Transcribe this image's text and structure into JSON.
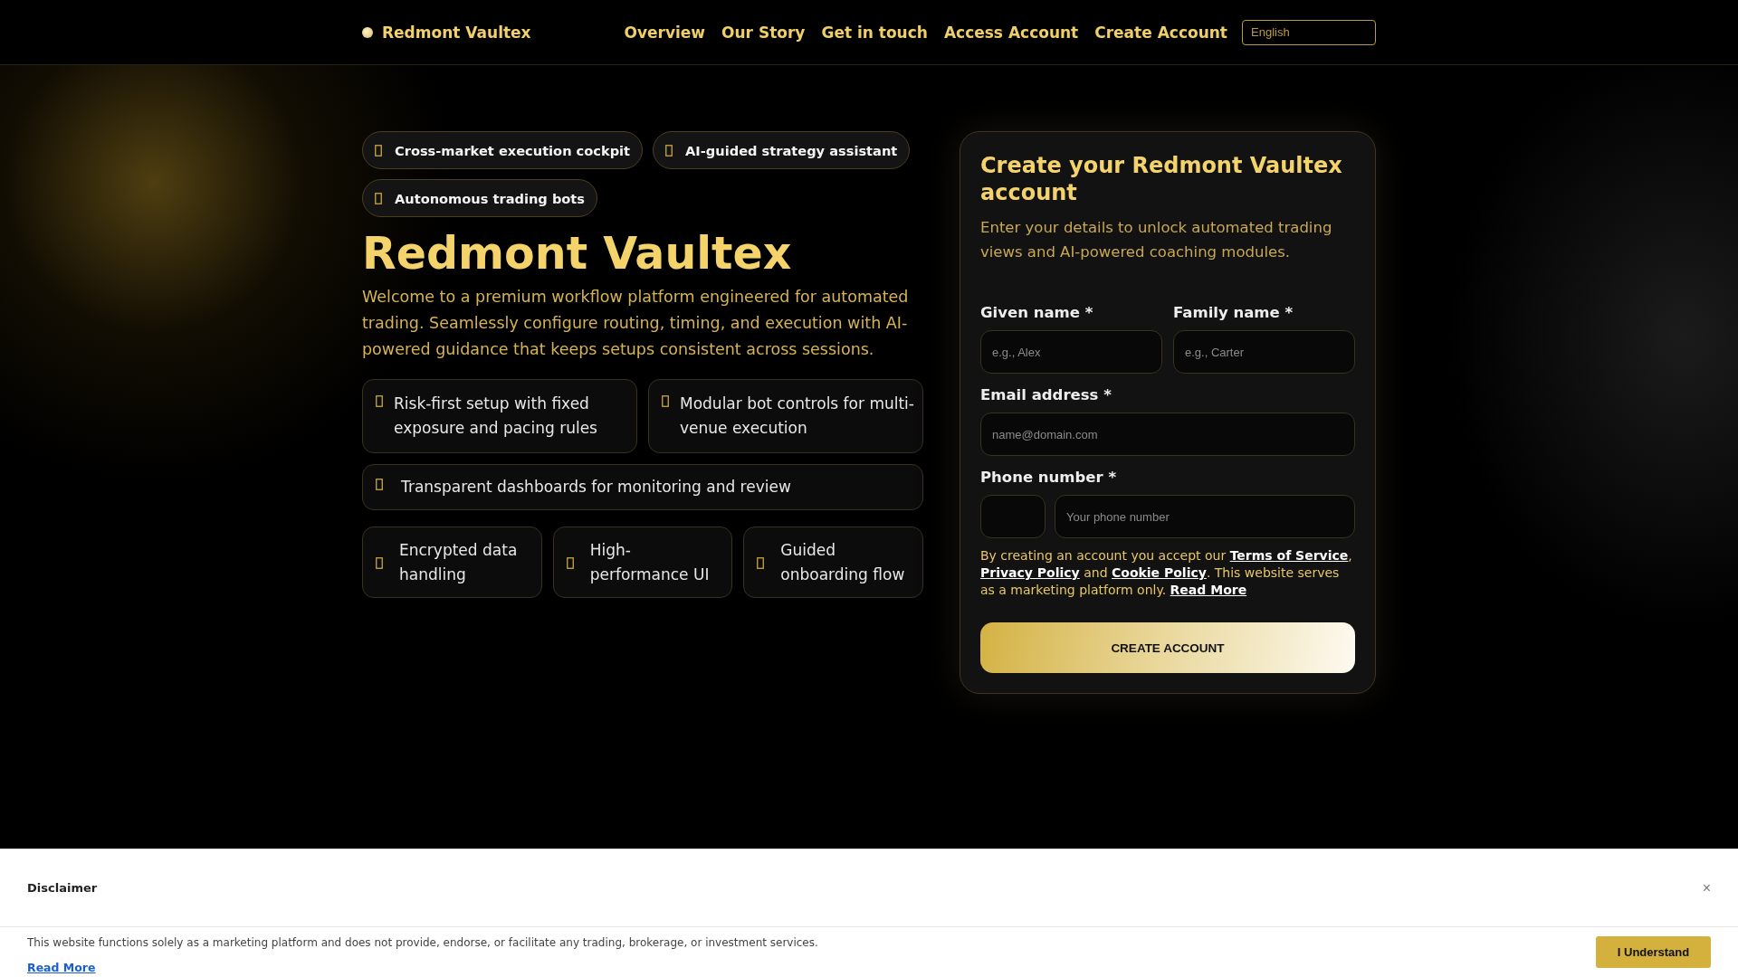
{
  "nav": {
    "brand": "Redmont Vaultex",
    "links": [
      "Overview",
      "Our Story",
      "Get in touch",
      "Access Account",
      "Create Account"
    ],
    "language": {
      "value": "English"
    }
  },
  "hero": {
    "chips": [
      "Cross-market execution cockpit",
      "AI-guided strategy assistant",
      "Autonomous trading bots"
    ],
    "title": "Redmont Vaultex",
    "intro": "Welcome to a premium workflow platform engineered for automated trading. Seamlessly configure routing, timing, and execution with AI-powered guidance that keeps setups consistent across sessions.",
    "features": [
      {
        "kind": "half",
        "text": "Risk-first setup with fixed exposure and pacing rules"
      },
      {
        "kind": "half",
        "text": "Modular bot controls for multi-venue execution"
      },
      {
        "kind": "full",
        "text": "Transparent dashboards for monitoring and review"
      },
      {
        "kind": "third",
        "text": "Encrypted data handling"
      },
      {
        "kind": "third",
        "text": "High-performance UI"
      },
      {
        "kind": "third",
        "text": "Guided onboarding flow"
      }
    ]
  },
  "form": {
    "title": "Create your Redmont Vaultex account",
    "subtitle": "Enter your details to unlock automated trading views and AI-powered coaching modules.",
    "given_name": {
      "label": "Given name *",
      "placeholder": "e.g., Alex"
    },
    "family_name": {
      "label": "Family name *",
      "placeholder": "e.g., Carter"
    },
    "email": {
      "label": "Email address *",
      "placeholder": "name@domain.com"
    },
    "phone": {
      "label": "Phone number *",
      "placeholder": "Your phone number"
    },
    "consent": [
      {
        "kind": "text",
        "text": "By creating an account you accept our "
      },
      {
        "kind": "link",
        "text": "Terms of Service"
      },
      {
        "kind": "text",
        "text": ", "
      },
      {
        "kind": "link",
        "text": "Privacy Policy"
      },
      {
        "kind": "text",
        "text": " and "
      },
      {
        "kind": "link",
        "text": "Cookie Policy"
      },
      {
        "kind": "text",
        "text": ". This website serves as a marketing platform only. "
      },
      {
        "kind": "link",
        "text": "Read More"
      }
    ],
    "submit": "CREATE ACCOUNT"
  },
  "disclaimer": {
    "title": "Disclaimer",
    "close": "×",
    "body": "This website functions solely as a marketing platform and does not provide, endorse, or facilitate any trading, brokerage, or investment services.",
    "read_more": "Read More",
    "button": "I Understand"
  }
}
